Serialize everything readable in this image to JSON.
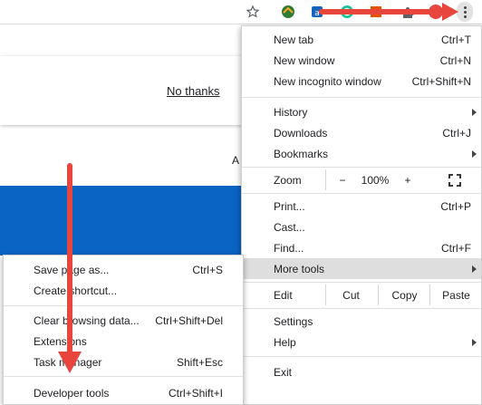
{
  "toolbar": {
    "icons": [
      "star-icon",
      "extension-icon-1",
      "extension-icon-2",
      "extension-icon-3",
      "extension-icon-4",
      "puzzle-icon",
      "avatar-icon",
      "more-vert-icon"
    ]
  },
  "page": {
    "no_thanks": "No thanks",
    "edge_text": "A"
  },
  "menu": {
    "new_tab": {
      "label": "New tab",
      "shortcut": "Ctrl+T"
    },
    "new_window": {
      "label": "New window",
      "shortcut": "Ctrl+N"
    },
    "new_incognito": {
      "label": "New incognito window",
      "shortcut": "Ctrl+Shift+N"
    },
    "history": {
      "label": "History"
    },
    "downloads": {
      "label": "Downloads",
      "shortcut": "Ctrl+J"
    },
    "bookmarks": {
      "label": "Bookmarks"
    },
    "zoom": {
      "label": "Zoom",
      "minus": "−",
      "level": "100%",
      "plus": "+"
    },
    "print": {
      "label": "Print...",
      "shortcut": "Ctrl+P"
    },
    "cast": {
      "label": "Cast..."
    },
    "find": {
      "label": "Find...",
      "shortcut": "Ctrl+F"
    },
    "more_tools": {
      "label": "More tools"
    },
    "edit": {
      "label": "Edit",
      "cut": "Cut",
      "copy": "Copy",
      "paste": "Paste"
    },
    "settings": {
      "label": "Settings"
    },
    "help": {
      "label": "Help"
    },
    "exit": {
      "label": "Exit"
    }
  },
  "submenu": {
    "save_page": {
      "label": "Save page as...",
      "shortcut": "Ctrl+S"
    },
    "create_shortcut": {
      "label": "Create shortcut..."
    },
    "clear_browsing": {
      "label": "Clear browsing data...",
      "shortcut": "Ctrl+Shift+Del"
    },
    "extensions": {
      "label": "Extensions"
    },
    "task_manager": {
      "label": "Task manager",
      "shortcut": "Shift+Esc"
    },
    "developer_tools": {
      "label": "Developer tools",
      "shortcut": "Ctrl+Shift+I"
    }
  },
  "colors": {
    "arrow": "#e8453c",
    "highlight": "#dedede",
    "blue_band": "#0a64c4"
  }
}
